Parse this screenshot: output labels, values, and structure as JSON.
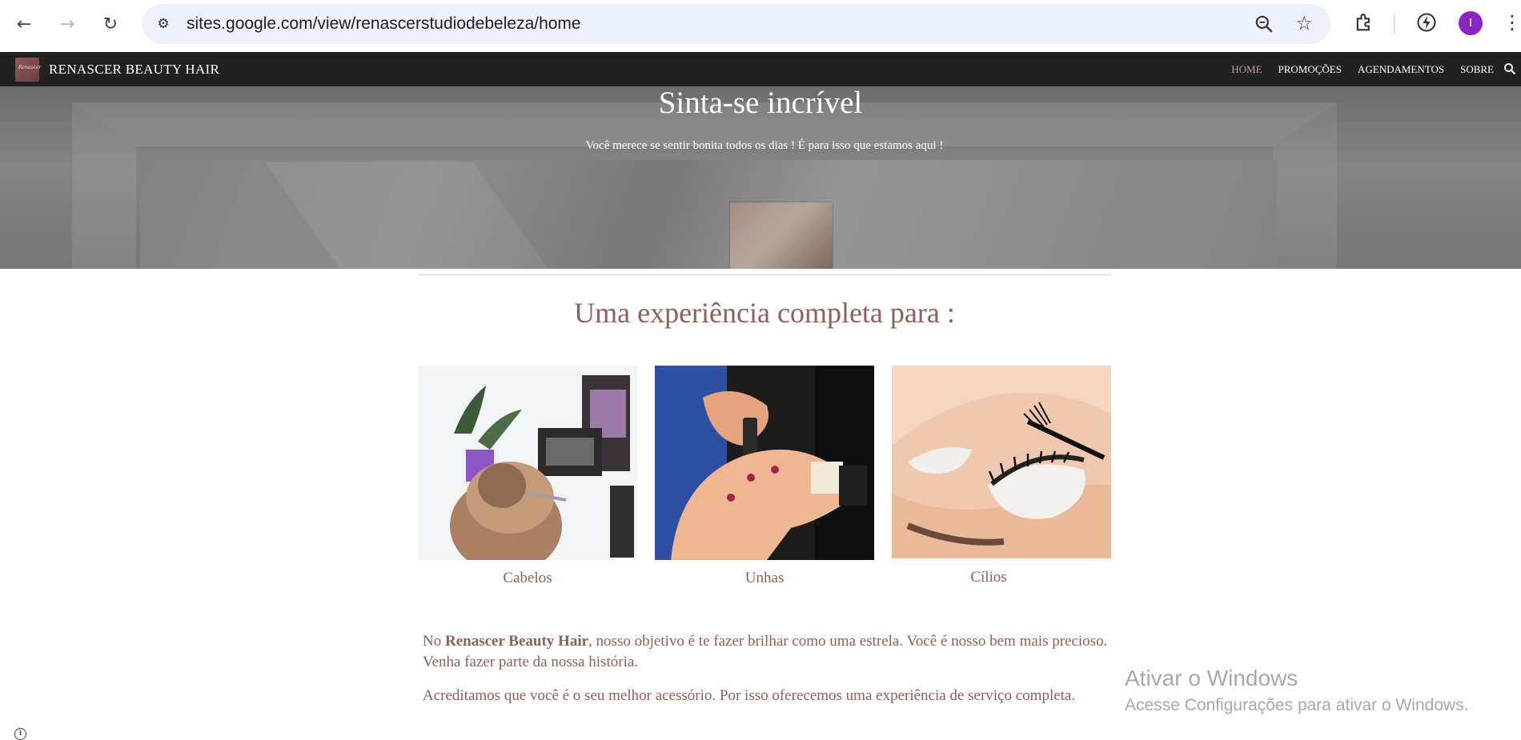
{
  "browser": {
    "url": "sites.google.com/view/renascerstudiodebeleza/home",
    "avatar_letter": "I",
    "back_icon": "←",
    "forward_icon": "→",
    "reload_icon": "↻",
    "tune_icon": "⚙",
    "star_icon": "☆",
    "kebab_icon": "⋮"
  },
  "site": {
    "title": "RENASCER BEAUTY HAIR",
    "logo_text": "Renascer",
    "nav": [
      {
        "label": "HOME",
        "active": true
      },
      {
        "label": "PROMOÇÕES",
        "active": false
      },
      {
        "label": "AGENDAMENTOS",
        "active": false
      },
      {
        "label": "SOBRE",
        "active": false
      }
    ]
  },
  "hero": {
    "title": "Sinta-se incrível",
    "subtitle": "Você merece se sentir bonita todos os dias ! É para isso que estamos aqui !"
  },
  "section": {
    "title": "Uma experiência completa para :"
  },
  "cards": [
    {
      "caption": "Cabelos"
    },
    {
      "caption": "Unhas"
    },
    {
      "caption": "Cílios"
    }
  ],
  "paragraph1": {
    "prefix": "No ",
    "bold": "Renascer Beauty Hair",
    "rest": ", nosso objetivo é te fazer brilhar como uma estrela. Você é nosso bem mais precioso. Venha fazer parte da nossa história."
  },
  "paragraph2": {
    "text": "Acreditamos que você é o seu melhor acessório. Por isso oferecemos uma experiência de serviço completa."
  },
  "windows": {
    "title": "Ativar o Windows",
    "message": "Acesse Configurações para ativar o Windows."
  },
  "info_icon": "i",
  "colors": {
    "brand": "#8d6058",
    "header_bg": "#212121",
    "nav_active": "#c49a94"
  }
}
